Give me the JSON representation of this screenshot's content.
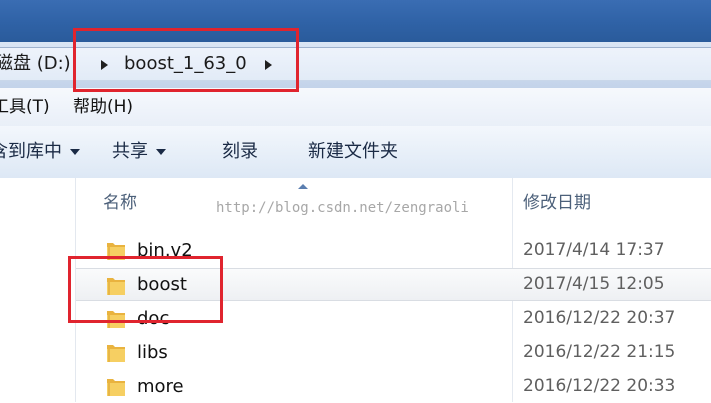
{
  "address_bar": {
    "drive_label": "磁盘 (D:)",
    "current_folder": "boost_1_63_0"
  },
  "menu": {
    "tools": "工具(T)",
    "help": "帮助(H)"
  },
  "toolbar": {
    "include_in_library": "包含到库中",
    "share": "共享",
    "burn": "刻录",
    "new_folder": "新建文件夹"
  },
  "columns": {
    "name": "名称",
    "date_modified": "修改日期"
  },
  "watermark": "http://blog.csdn.net/zengraoli",
  "files": [
    {
      "name": "bin.v2",
      "date": "2017/4/14 17:37"
    },
    {
      "name": "boost",
      "date": "2017/4/15 12:05"
    },
    {
      "name": "doc",
      "date": "2016/12/22 20:37"
    },
    {
      "name": "libs",
      "date": "2016/12/22 21:15"
    },
    {
      "name": "more",
      "date": "2016/12/22 20:33"
    }
  ],
  "colors": {
    "highlight_box": "#e0242e",
    "folder": "#f2c14e",
    "title_bar": "#2f62a6"
  }
}
